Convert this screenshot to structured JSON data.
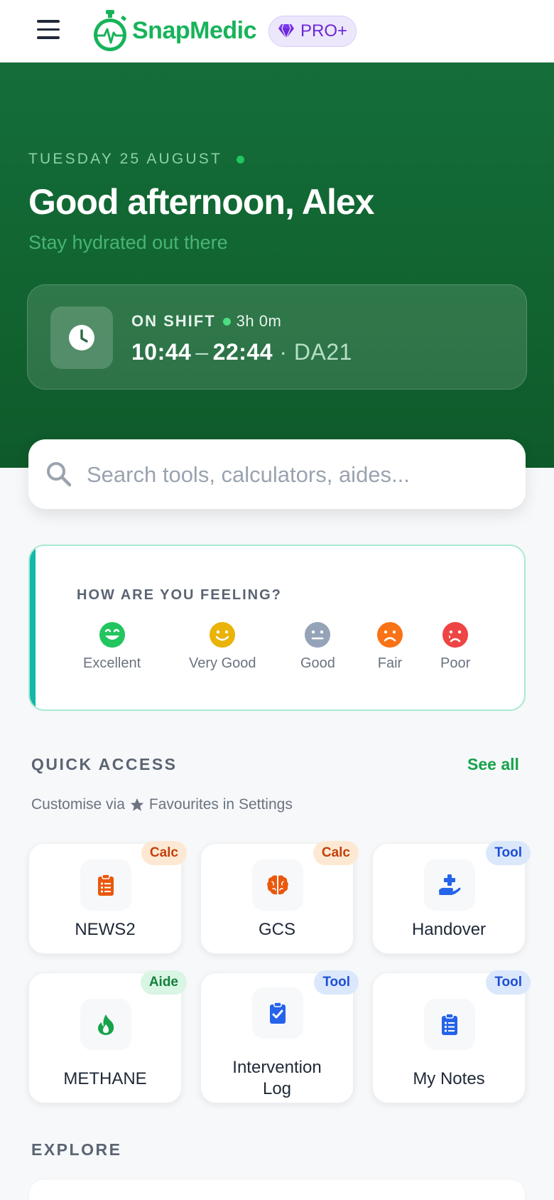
{
  "app": {
    "brand": "SnapMedic",
    "badge": "PRO+"
  },
  "hero": {
    "date": "TUESDAY 25 AUGUST",
    "greeting": "Good afternoon, Alex",
    "subtitle": "Stay hydrated out there",
    "shift": {
      "status": "ON SHIFT",
      "duration": "3h 0m",
      "start": "10:44",
      "separator": "–",
      "end": "22:44",
      "code": "· DA21"
    }
  },
  "search": {
    "placeholder": "Search tools, calculators, aides..."
  },
  "feeling": {
    "title": "HOW ARE YOU FEELING?",
    "moods": [
      {
        "label": "Excellent",
        "color": "#22c55e"
      },
      {
        "label": "Very Good",
        "color": "#eab308"
      },
      {
        "label": "Good",
        "color": "#94a3b8"
      },
      {
        "label": "Fair",
        "color": "#f97316"
      },
      {
        "label": "Poor",
        "color": "#ef4444"
      }
    ]
  },
  "quick_access": {
    "title": "QUICK ACCESS",
    "see_all": "See all",
    "hint_before": "Customise via",
    "hint_after": "Favourites in Settings",
    "tiles": [
      {
        "label": "NEWS2",
        "tag": "Calc",
        "icon": "clipboard-list-icon",
        "color": "#ea580c"
      },
      {
        "label": "GCS",
        "tag": "Calc",
        "icon": "brain-icon",
        "color": "#ea580c"
      },
      {
        "label": "Handover",
        "tag": "Tool",
        "icon": "hand-holding-medical-icon",
        "color": "#2563eb"
      },
      {
        "label": "METHANE",
        "tag": "Aide",
        "icon": "fire-icon",
        "color": "#16a34a"
      },
      {
        "label": "Intervention Log",
        "tag": "Tool",
        "icon": "clipboard-check-icon",
        "color": "#2563eb"
      },
      {
        "label": "My Notes",
        "tag": "Tool",
        "icon": "clipboard-list-icon",
        "color": "#2563eb"
      }
    ]
  },
  "explore": {
    "title": "EXPLORE"
  }
}
